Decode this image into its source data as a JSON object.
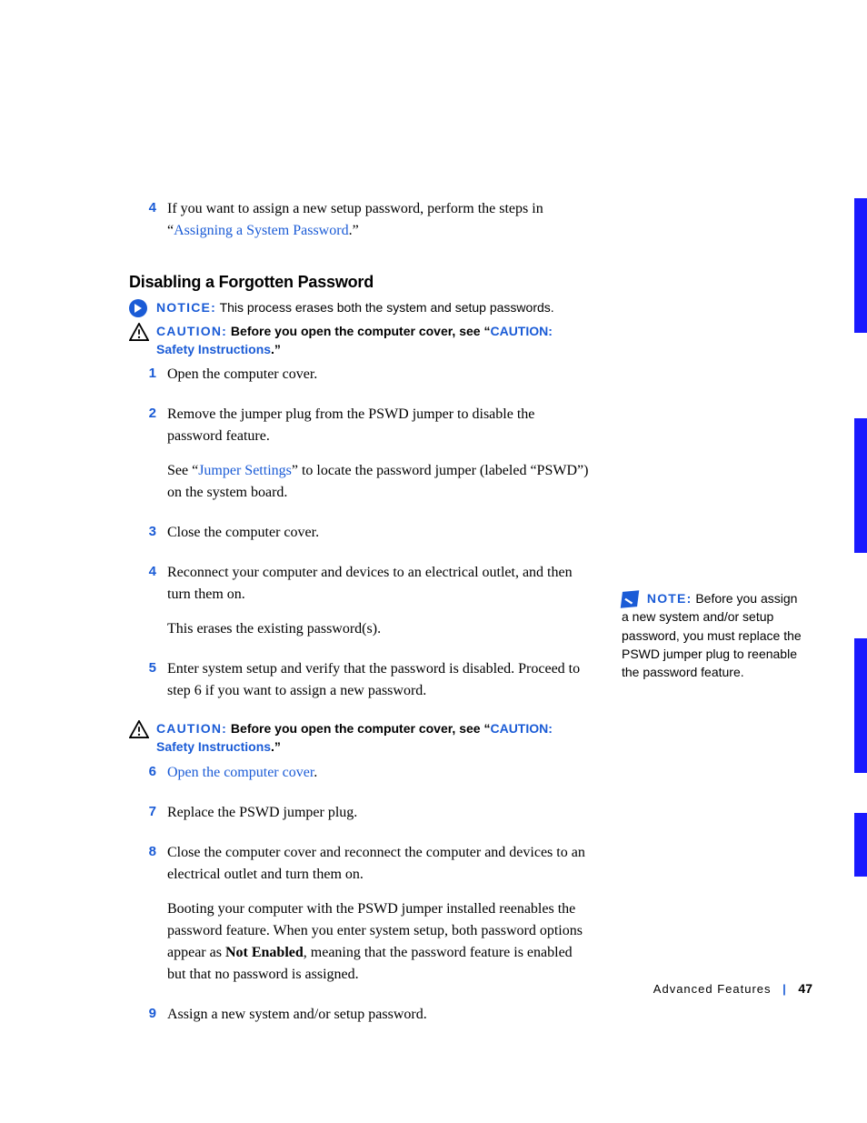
{
  "topStep": {
    "num": "4",
    "text_a": "If you want to assign a new setup password, perform the steps in “",
    "link": "Assigning a System Password",
    "text_b": ".”"
  },
  "heading": "Disabling a Forgotten Password",
  "notice": {
    "label": "NOTICE:",
    "text": " This process erases both the system and setup passwords."
  },
  "caution1": {
    "label": "CAUTION:",
    "text_a": " Before you open the computer cover, see “",
    "link": "CAUTION: Safety Instructions",
    "text_b": ".”"
  },
  "steps": [
    {
      "num": "1",
      "paras": [
        {
          "plain": "Open the computer cover."
        }
      ]
    },
    {
      "num": "2",
      "paras": [
        {
          "plain": "Remove the jumper plug from the PSWD jumper to disable the password feature."
        },
        {
          "pre": "See “",
          "link": "Jumper Settings",
          "post": "” to locate the password jumper (labeled “PSWD”) on the system board."
        }
      ]
    },
    {
      "num": "3",
      "paras": [
        {
          "plain": "Close the computer cover."
        }
      ]
    },
    {
      "num": "4",
      "paras": [
        {
          "plain": "Reconnect your computer and devices to an electrical outlet, and then turn them on."
        },
        {
          "plain": "This erases the existing password(s)."
        }
      ]
    },
    {
      "num": "5",
      "paras": [
        {
          "plain": "Enter system setup and verify that the password is disabled. Proceed to step 6 if you want to assign a new password."
        }
      ]
    }
  ],
  "caution2": {
    "label": "CAUTION:",
    "text_a": " Before you open the computer cover, see “",
    "link": "CAUTION: Safety Instructions",
    "text_b": ".”"
  },
  "steps2": [
    {
      "num": "6",
      "paras": [
        {
          "link_only": "Open the computer cover",
          "post": "."
        }
      ]
    },
    {
      "num": "7",
      "paras": [
        {
          "plain": "Replace the PSWD jumper plug."
        }
      ]
    },
    {
      "num": "8",
      "paras": [
        {
          "plain": "Close the computer cover and reconnect the computer and devices to an electrical outlet and turn them on."
        },
        {
          "pre": "Booting your computer with the PSWD jumper installed reenables the password feature. When you enter system setup, both password options appear as ",
          "bold": "Not Enabled",
          "post": ", meaning that the password feature is enabled but that no password is assigned."
        }
      ]
    },
    {
      "num": "9",
      "paras": [
        {
          "plain": "Assign a new system and/or setup password."
        }
      ]
    }
  ],
  "sidebarNote": {
    "label": "NOTE:",
    "text": " Before you assign a new system and/or setup password, you must replace the PSWD jumper plug to reenable the password feature."
  },
  "footer": {
    "section": "Advanced Features",
    "page": "47"
  }
}
